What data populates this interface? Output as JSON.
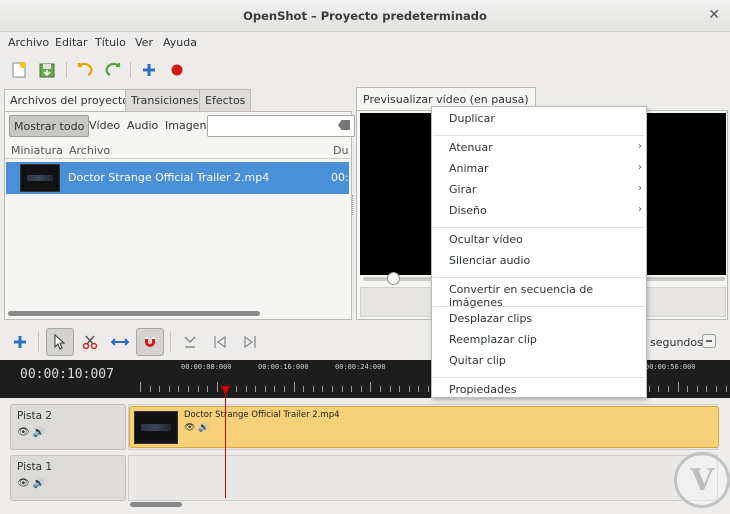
{
  "window": {
    "title": "OpenShot – Proyecto predeterminado"
  },
  "menubar": [
    "Archivo",
    "Editar",
    "Título",
    "Ver",
    "Ayuda"
  ],
  "toolbar": {
    "icons": [
      "new-project-icon",
      "save-project-icon",
      "undo-icon",
      "redo-icon",
      "add-track-icon",
      "record-icon"
    ]
  },
  "left_tabs": [
    "Archivos del proyecto",
    "Transiciones",
    "Efectos"
  ],
  "filters": [
    "Mostrar todo",
    "Vídeo",
    "Audio",
    "Imagen"
  ],
  "search": {
    "value": "",
    "placeholder": ""
  },
  "file_columns": [
    "Miniatura",
    "Archivo",
    "Du"
  ],
  "files": [
    {
      "name": "Doctor Strange Official Trailer 2.mp4",
      "duration": "00:"
    }
  ],
  "preview_tab": "Previsualizar vídeo (en pausa)",
  "timeline": {
    "timecode": "00:00:10:007",
    "ruler_labels": [
      "00:00:08:000",
      "00:00:16:000",
      "00:00:24:000",
      "00:00:56:000"
    ],
    "zoom_label": "segundos",
    "tracks": [
      {
        "name": "Pista 2",
        "clip": "Doctor Strange Official Trailer 2.mp4"
      },
      {
        "name": "Pista 1",
        "clip": ""
      }
    ]
  },
  "context_menu": {
    "groups": [
      [
        {
          "label": "Duplicar",
          "submenu": false
        }
      ],
      [
        {
          "label": "Atenuar",
          "submenu": true
        },
        {
          "label": "Animar",
          "submenu": true
        },
        {
          "label": "Girar",
          "submenu": true
        },
        {
          "label": "Diseño",
          "submenu": true
        }
      ],
      [
        {
          "label": "Ocultar vídeo",
          "submenu": false
        },
        {
          "label": "Silenciar audio",
          "submenu": false
        }
      ],
      [
        {
          "label": "Convertir en secuencia de imágenes",
          "submenu": false
        }
      ],
      [
        {
          "label": "Desplazar clips",
          "submenu": false
        },
        {
          "label": "Reemplazar clip",
          "submenu": false
        },
        {
          "label": "Quitar clip",
          "submenu": false
        }
      ],
      [
        {
          "label": "Propiedades",
          "submenu": false
        }
      ]
    ]
  },
  "colors": {
    "selection": "#4a90d9",
    "clip": "#f6d17a",
    "playhead": "#d90000",
    "ruler_bg": "#1d1d1d"
  }
}
